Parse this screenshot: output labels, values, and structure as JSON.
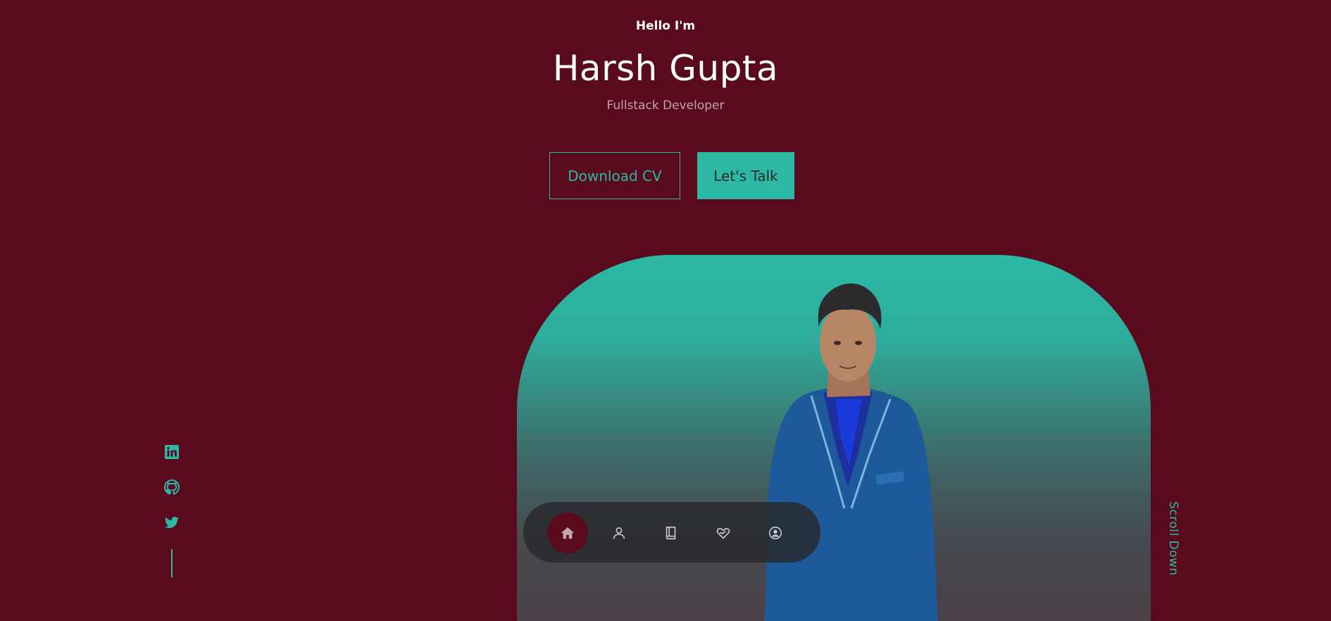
{
  "header": {
    "greeting": "Hello I'm",
    "name": "Harsh Gupta",
    "role": "Fullstack Developer"
  },
  "actions": {
    "download_cv": "Download CV",
    "lets_talk": "Let's Talk"
  },
  "socials": [
    {
      "icon": "linkedin-icon"
    },
    {
      "icon": "github-icon"
    },
    {
      "icon": "twitter-icon"
    }
  ],
  "scroll_down": "Scroll Down",
  "nav": {
    "active": "home",
    "items": [
      {
        "icon": "home-icon"
      },
      {
        "icon": "user-icon"
      },
      {
        "icon": "book-icon"
      },
      {
        "icon": "services-icon"
      },
      {
        "icon": "contact-icon"
      }
    ]
  },
  "colors": {
    "background": "#5a0a1d",
    "accent": "#2cb8a4",
    "muted_text": "#c4a4ae"
  }
}
